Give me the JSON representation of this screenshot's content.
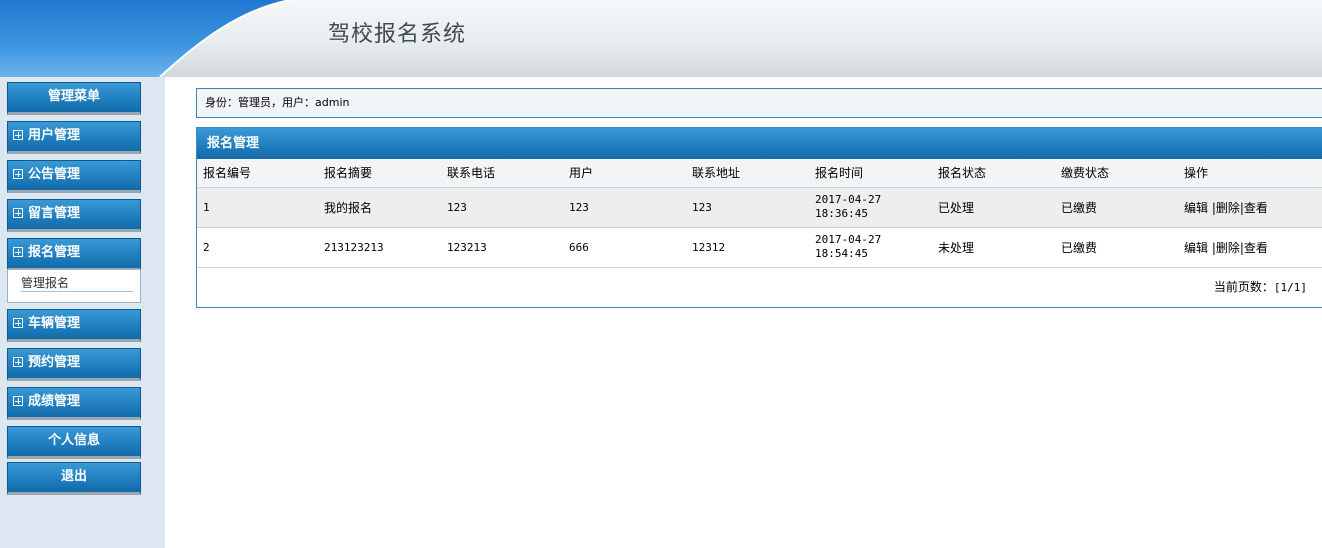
{
  "app": {
    "title": "驾校报名系统"
  },
  "sidebar": {
    "menu_title": "管理菜单",
    "items": [
      {
        "label": "用户管理"
      },
      {
        "label": "公告管理"
      },
      {
        "label": "留言管理"
      },
      {
        "label": "报名管理",
        "sub_items": [
          {
            "label": "管理报名"
          }
        ]
      },
      {
        "label": "车辆管理"
      },
      {
        "label": "预约管理"
      },
      {
        "label": "成绩管理"
      }
    ],
    "personal": "个人信息",
    "logout": "退出"
  },
  "identity_bar": {
    "text": "身份：管理员，用户：admin"
  },
  "panel": {
    "title": "报名管理",
    "columns": [
      "报名编号",
      "报名摘要",
      "联系电话",
      "用户",
      "联系地址",
      "报名时间",
      "报名状态",
      "缴费状态",
      "操作"
    ],
    "rows": [
      {
        "id": "1",
        "summary": "我的报名",
        "phone": "123",
        "user": "123",
        "address": "123",
        "date": "2017-04-27",
        "time": "18:36:45",
        "status": "已处理",
        "payment": "已缴费"
      },
      {
        "id": "2",
        "summary": "213123213",
        "phone": "123213",
        "user": "666",
        "address": "12312",
        "date": "2017-04-27",
        "time": "18:54:45",
        "status": "未处理",
        "payment": "已缴费"
      }
    ],
    "actions": {
      "edit": "编辑",
      "delete": "|删除",
      "view": "|查看"
    },
    "pager": {
      "label": "当前页数：",
      "value": "[1/1]"
    }
  },
  "colors": {
    "accent": "#1f7fc0",
    "sidebar_bg": "#dce7f2",
    "border": "#3d87b7"
  }
}
